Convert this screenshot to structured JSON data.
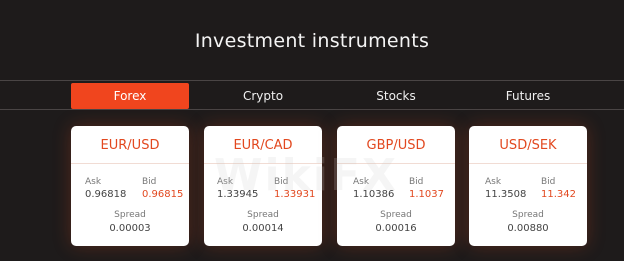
{
  "page": {
    "title": "Investment instruments"
  },
  "tabs": [
    {
      "label": "Forex"
    },
    {
      "label": "Crypto"
    },
    {
      "label": "Stocks"
    },
    {
      "label": "Futures"
    }
  ],
  "active_tab": "Forex",
  "labels": {
    "ask": "Ask",
    "bid": "Bid",
    "spread": "Spread"
  },
  "cards": [
    {
      "pair": "EUR/USD",
      "ask": "0.96818",
      "bid": "0.96815",
      "spread": "0.00003"
    },
    {
      "pair": "EUR/CAD",
      "ask": "1.33945",
      "bid": "1.33931",
      "spread": "0.00014"
    },
    {
      "pair": "GBP/USD",
      "ask": "1.10386",
      "bid": "1.1037",
      "spread": "0.00016"
    },
    {
      "pair": "USD/SEK",
      "ask": "11.3508",
      "bid": "11.342",
      "spread": "0.00880"
    }
  ],
  "watermark": "WikiFX",
  "colors": {
    "accent": "#f0451e",
    "background": "#1e1b1b",
    "card": "#ffffff"
  }
}
